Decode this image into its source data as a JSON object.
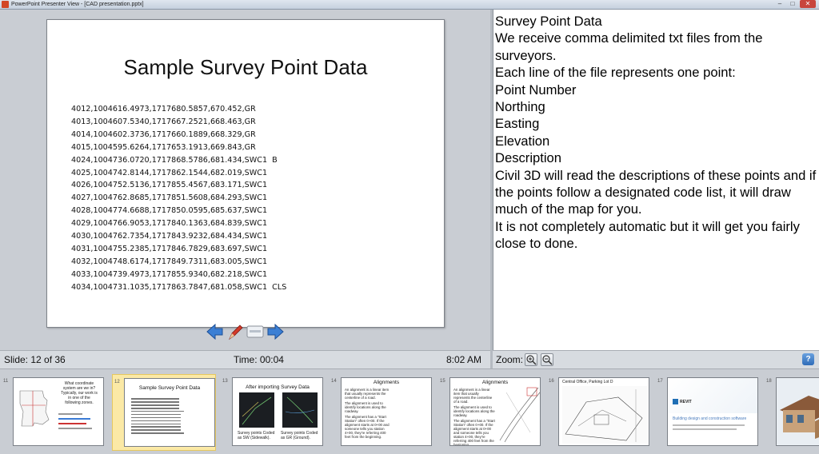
{
  "window": {
    "title": "PowerPoint Presenter View - [CAD presentation.pptx]",
    "minimize": "–",
    "maximize": "□",
    "close": "✕"
  },
  "slide": {
    "title": "Sample Survey Point Data",
    "lines": [
      "4012,1004616.4973,1717680.5857,670.452,GR",
      "4013,1004607.5340,1717667.2521,668.463,GR",
      "4014,1004602.3736,1717660.1889,668.329,GR",
      "4015,1004595.6264,1717653.1913,669.843,GR",
      "4024,1004736.0720,1717868.5786,681.434,SWC1  B",
      "4025,1004742.8144,1717862.1544,682.019,SWC1",
      "4026,1004752.5136,1717855.4567,683.171,SWC1",
      "4027,1004762.8685,1717851.5608,684.293,SWC1",
      "4028,1004774.6688,1717850.0595,685.637,SWC1",
      "4029,1004766.9053,1717840.1363,684.839,SWC1",
      "4030,1004762.7354,1717843.9232,684.434,SWC1",
      "4031,1004755.2385,1717846.7829,683.697,SWC1",
      "4032,1004748.6174,1717849.7311,683.005,SWC1",
      "4033,1004739.4973,1717855.9340,682.218,SWC1",
      "4034,1004731.1035,1717863.7847,681.058,SWC1  CLS"
    ]
  },
  "nav": {
    "prev_icon": "arrow-left-icon",
    "pen_icon": "pen-icon",
    "menu_icon": "slide-menu-icon",
    "next_icon": "arrow-right-icon"
  },
  "status": {
    "slide": "Slide: 12 of 36",
    "time": "Time: 00:04",
    "clock": "8:02 AM",
    "zoom_label": "Zoom:",
    "help": "?"
  },
  "notes": [
    "Survey Point Data",
    "We receive comma delimited txt files from the surveyors.",
    "Each line of the file represents one point:",
    "Point Number",
    "Northing",
    "Easting",
    "Elevation",
    "Description",
    "Civil 3D will read the descriptions of these points and if the points follow a designated code list, it will draw much of the map for you.",
    "It is not completely automatic but it will get you fairly close to done."
  ],
  "thumbnails": [
    {
      "num": "11",
      "lines": [
        "What coordinate",
        "system are we in?",
        "Typically, our work is",
        "in one of the",
        "following zones."
      ]
    },
    {
      "num": "12",
      "title": "Sample Survey Point Data",
      "selected": true
    },
    {
      "num": "13",
      "title": "After importing Survey Data",
      "captions": [
        "Survey points Coded as SW (Sidewalk).",
        "Survey points Coded as GR (Ground)."
      ]
    },
    {
      "num": "14",
      "title": "Alignments",
      "bullets": [
        "An alignment is a linear item that usually represents the centerline of a road.",
        "The alignment is used to identify locations along the roadway.",
        "The alignment has a \"Start Station\" often 0+00. If the alignment starts at 0+00 and someone tells you station 4+00, they're referring 400 feet from the beginning."
      ]
    },
    {
      "num": "15",
      "title": "Alignments",
      "bullets": [
        "An alignment is a linear item that usually represents the centerline of a road.",
        "The alignment is used to identify locations along the roadway.",
        "The alignment has a \"Start Station\" often 0+00. If the alignment starts at 0+00 and someone tells you station 4+00, they're referring 400 feet from the beginning."
      ]
    },
    {
      "num": "16",
      "title": "Central Office, Parking Lot D"
    },
    {
      "num": "17",
      "brand": "REVIT",
      "subtitle": "Building design and construction software"
    },
    {
      "num": "18"
    }
  ],
  "colors": {
    "accent_selected": "#fbe9a6",
    "nav_arrow": "#3b7fd4",
    "pen_red": "#d23a2a"
  }
}
